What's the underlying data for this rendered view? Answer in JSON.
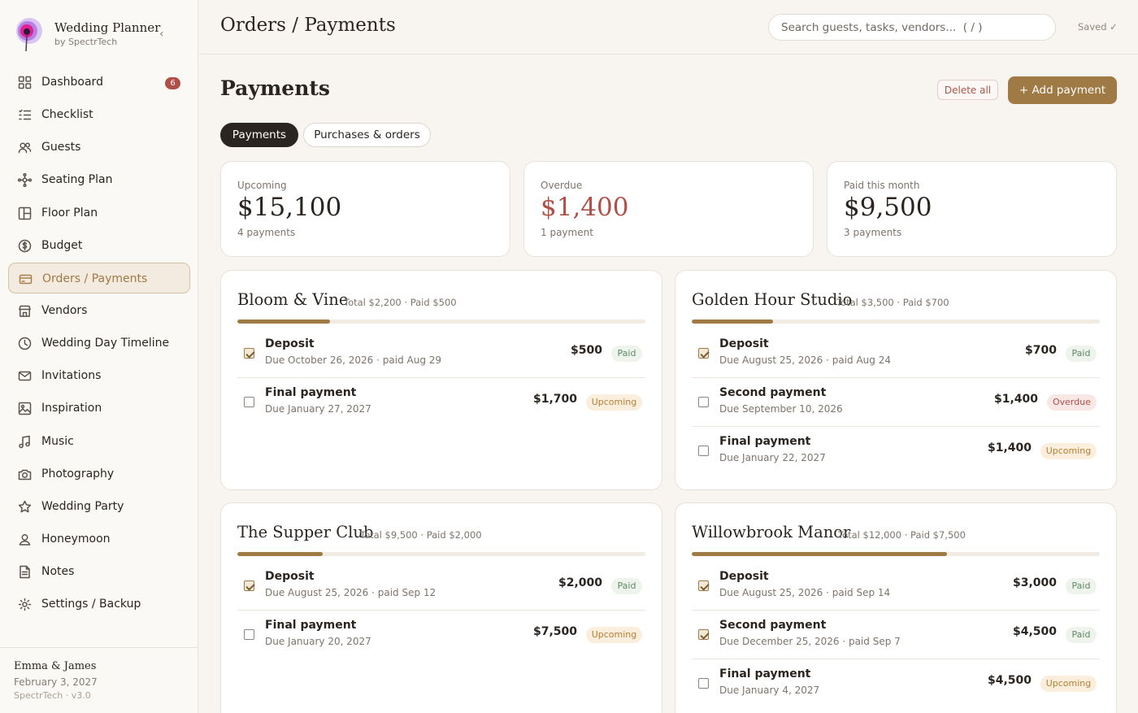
{
  "app": {
    "name": "Wedding Planner",
    "byline": "by SpectrTech"
  },
  "sidebar": {
    "items": [
      {
        "label": "Dashboard",
        "icon": "grid-icon",
        "badge": "6"
      },
      {
        "label": "Checklist",
        "icon": "checklist-icon"
      },
      {
        "label": "Guests",
        "icon": "users-icon"
      },
      {
        "label": "Seating Plan",
        "icon": "network-icon"
      },
      {
        "label": "Floor Plan",
        "icon": "floorplan-icon"
      },
      {
        "label": "Budget",
        "icon": "dollar-icon"
      },
      {
        "label": "Orders / Payments",
        "icon": "card-icon",
        "active": true
      },
      {
        "label": "Vendors",
        "icon": "store-icon"
      },
      {
        "label": "Wedding Day Timeline",
        "icon": "clock-icon"
      },
      {
        "label": "Invitations",
        "icon": "mail-icon"
      },
      {
        "label": "Inspiration",
        "icon": "image-icon"
      },
      {
        "label": "Music",
        "icon": "music-icon"
      },
      {
        "label": "Photography",
        "icon": "camera-icon"
      },
      {
        "label": "Wedding Party",
        "icon": "star-icon"
      },
      {
        "label": "Honeymoon",
        "icon": "person-icon"
      },
      {
        "label": "Notes",
        "icon": "note-icon"
      },
      {
        "label": "Settings / Backup",
        "icon": "gear-icon"
      }
    ],
    "footer": {
      "couple": "Emma & James",
      "date": "February 3, 2027",
      "version": "SpectrTech · v3.0"
    }
  },
  "header": {
    "breadcrumb": "Orders / Payments",
    "search_placeholder": "Search guests, tasks, vendors...  ( / )",
    "save_status": "Saved ✓"
  },
  "page": {
    "title": "Payments",
    "delete_all": "Delete all",
    "add_payment": "+ Add payment",
    "tabs": [
      {
        "label": "Payments",
        "active": true
      },
      {
        "label": "Purchases & orders",
        "active": false
      }
    ]
  },
  "stats": [
    {
      "label": "Upcoming",
      "value": "$15,100",
      "sub": "4 payments"
    },
    {
      "label": "Overdue",
      "value": "$1,400",
      "sub": "1 payment",
      "color": "#b04f47"
    },
    {
      "label": "Paid this month",
      "value": "$9,500",
      "sub": "3 payments"
    }
  ],
  "vendors": [
    {
      "name": "Bloom & Vine",
      "meta": "Total $2,200 · Paid $500",
      "progress": 0.227,
      "payments": [
        {
          "name": "Deposit",
          "due": "Due October 26, 2026 · paid Aug 29",
          "amount": "$500",
          "status": "Paid",
          "checked": true
        },
        {
          "name": "Final payment",
          "due": "Due January 27, 2027",
          "amount": "$1,700",
          "status": "Upcoming",
          "checked": false
        }
      ]
    },
    {
      "name": "Golden Hour Studio",
      "meta": "Total $3,500 · Paid $700",
      "progress": 0.2,
      "payments": [
        {
          "name": "Deposit",
          "due": "Due August 25, 2026 · paid Aug 24",
          "amount": "$700",
          "status": "Paid",
          "checked": true
        },
        {
          "name": "Second payment",
          "due": "Due September 10, 2026",
          "amount": "$1,400",
          "status": "Overdue",
          "checked": false
        },
        {
          "name": "Final payment",
          "due": "Due January 22, 2027",
          "amount": "$1,400",
          "status": "Upcoming",
          "checked": false
        }
      ]
    },
    {
      "name": "The Supper Club",
      "meta": "Total $9,500 · Paid $2,000",
      "progress": 0.21,
      "payments": [
        {
          "name": "Deposit",
          "due": "Due August 25, 2026 · paid Sep 12",
          "amount": "$2,000",
          "status": "Paid",
          "checked": true
        },
        {
          "name": "Final payment",
          "due": "Due January 20, 2027",
          "amount": "$7,500",
          "status": "Upcoming",
          "checked": false
        }
      ]
    },
    {
      "name": "Willowbrook Manor",
      "meta": "Total $12,000 · Paid $7,500",
      "progress": 0.625,
      "payments": [
        {
          "name": "Deposit",
          "due": "Due August 25, 2026 · paid Sep 14",
          "amount": "$3,000",
          "status": "Paid",
          "checked": true
        },
        {
          "name": "Second payment",
          "due": "Due December 25, 2026 · paid Sep 7",
          "amount": "$4,500",
          "status": "Paid",
          "checked": true
        },
        {
          "name": "Final payment",
          "due": "Due January 4, 2027",
          "amount": "$4,500",
          "status": "Upcoming",
          "checked": false
        }
      ]
    }
  ],
  "colors": {
    "accent": "#9f7a44",
    "danger": "#b04f47",
    "paid": "#5d8a66",
    "upcoming": "#b47f36"
  }
}
